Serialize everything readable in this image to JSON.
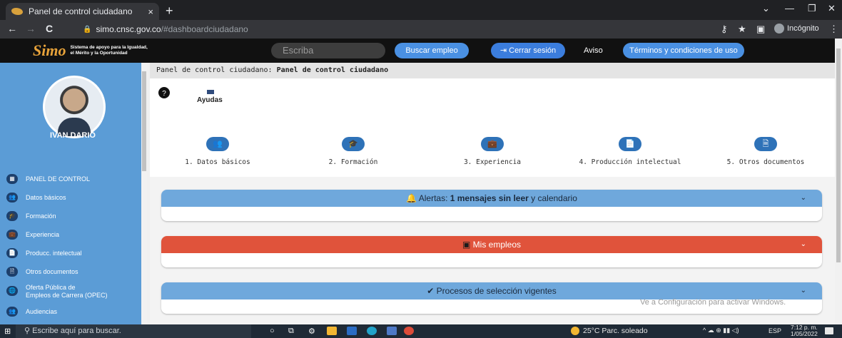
{
  "browser": {
    "tab_title": "Panel de control ciudadano",
    "tab_close": "×",
    "new_tab": "+",
    "url_host": "simo.cnsc.gov.co",
    "url_path": "/#dashboardciudadano",
    "profile_label": "Incógnito",
    "nav_back": "←",
    "nav_forward": "→",
    "nav_reload": "C"
  },
  "header": {
    "logo_mark": "Simo",
    "logo_line1": "Sistema de apoyo para la Igualdad,",
    "logo_line2": "el Mérito y la Oportunidad",
    "search_placeholder": "Escriba",
    "buscar_empleo": "Buscar empleo",
    "cerrar_sesion": "Cerrar sesión",
    "aviso": "Aviso",
    "terminos": "Términos y condiciones de uso"
  },
  "sidebar": {
    "user_name": "IVAN DARIO",
    "items": [
      {
        "label": "PANEL DE CONTROL",
        "icon": "dashboard-icon",
        "glyph": "▦"
      },
      {
        "label": "Datos básicos",
        "icon": "people-icon",
        "glyph": "👥"
      },
      {
        "label": "Formación",
        "icon": "education-icon",
        "glyph": "🎓"
      },
      {
        "label": "Experiencia",
        "icon": "briefcase-icon",
        "glyph": "💼"
      },
      {
        "label": "Producc. intelectual",
        "icon": "document-icon",
        "glyph": "📄"
      },
      {
        "label": "Otros documentos",
        "icon": "file-icon",
        "glyph": "🗎"
      },
      {
        "label": "Oferta Pública de",
        "label2": "Empleos de Carrera (OPEC)",
        "icon": "globe-icon",
        "glyph": "🌐"
      },
      {
        "label": "Audiencias",
        "icon": "audience-icon",
        "glyph": "👥"
      }
    ]
  },
  "main": {
    "breadcrumb_prefix": "Panel de control ciudadano: ",
    "breadcrumb_bold": "Panel de control ciudadano",
    "ayudas": "Ayudas",
    "steps": [
      {
        "label": "1. Datos básicos",
        "glyph": "👥"
      },
      {
        "label": "2. Formación",
        "glyph": "🎓"
      },
      {
        "label": "3. Experiencia",
        "glyph": "💼"
      },
      {
        "label": "4. Producción intelectual",
        "glyph": "📄"
      },
      {
        "label": "5. Otros documentos",
        "glyph": "🗎"
      }
    ],
    "panels": {
      "alertas_prefix": "Alertas: ",
      "alertas_bold": "1 mensajes sin leer",
      "alertas_suffix": " y calendario",
      "mis_empleos": "Mis empleos",
      "procesos": "Procesos de selección vigentes"
    },
    "watermark": "Ve a Configuración para activar Windows."
  },
  "taskbar": {
    "search_placeholder": "Escribe aquí para buscar.",
    "weather": "25°C  Parc. soleado",
    "language": "ESP",
    "time": "7:12 p. m.",
    "date": "1/05/2022"
  },
  "colors": {
    "alertas": "#5b9cd6",
    "mis_empleos": "#e0533b",
    "procesos": "#5b9cd6"
  }
}
